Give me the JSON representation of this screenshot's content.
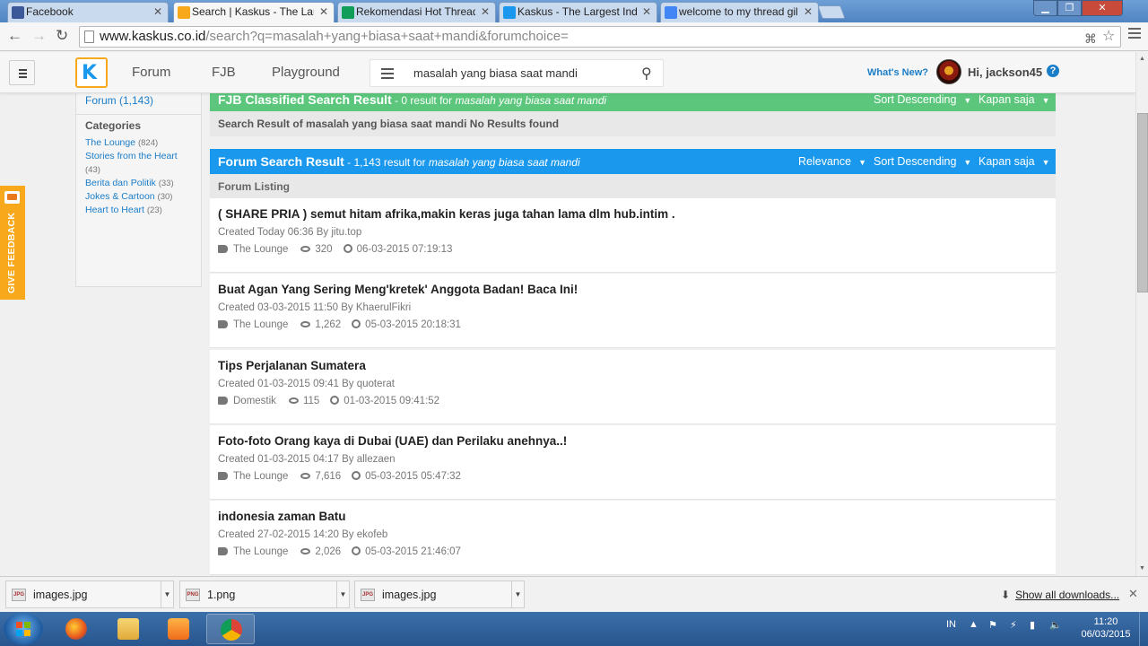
{
  "browser": {
    "tabs": [
      {
        "title": "Facebook",
        "favicon_color": "#3b5998",
        "active": false
      },
      {
        "title": "Search | Kaskus - The Larg",
        "favicon_color": "#1998ed",
        "active": true
      },
      {
        "title": "Rekomendasi Hot Thread",
        "favicon_color": "#0f9d58",
        "active": false
      },
      {
        "title": "Kaskus - The Largest Indo",
        "favicon_color": "#1998ed",
        "active": false
      },
      {
        "title": "welcome to my thread gil",
        "favicon_color": "#4285f4",
        "active": false
      }
    ],
    "url_host": "www.kaskus.co.id",
    "url_path": "/search?q=masalah+yang+biasa+saat+mandi&forumchoice="
  },
  "header": {
    "logo_letter": "K",
    "nav": [
      "Forum",
      "FJB",
      "Playground"
    ],
    "search_value": "masalah yang biasa saat mandi",
    "whats_new": "What's New?",
    "greeting": "Hi, jackson45",
    "help": "?"
  },
  "sidebar": {
    "forum_count": "Forum (1,143)",
    "categories_title": "Categories",
    "categories": [
      {
        "name": "The Lounge",
        "count": "(824)"
      },
      {
        "name": "Stories from the Heart",
        "count": "(43)"
      },
      {
        "name": "Berita dan Politik",
        "count": "(33)"
      },
      {
        "name": "Jokes & Cartoon",
        "count": "(30)"
      },
      {
        "name": "Heart to Heart",
        "count": "(23)"
      }
    ]
  },
  "feedback": {
    "label": "GIVE FEEDBACK"
  },
  "fjb": {
    "title": "FJB Classified Search Result",
    "sub_prefix": " - 0 result for ",
    "sub_query": "masalah yang biasa saat mandi",
    "sort": "Sort Descending",
    "time": "Kapan saja",
    "no_result": "Search Result of masalah yang biasa saat mandi No Results found"
  },
  "forum": {
    "title": "Forum Search Result",
    "sub_prefix": " - 1,143 result for ",
    "sub_query": "masalah yang biasa saat mandi",
    "relevance": "Relevance",
    "sort": "Sort Descending",
    "time": "Kapan saja",
    "listing": "Forum Listing"
  },
  "results": [
    {
      "title": "( SHARE PRIA ) semut hitam afrika,makin keras juga tahan lama dlm hub.intim .",
      "created": "Created Today 06:36 By jitu.top",
      "category": "The Lounge",
      "views": "320",
      "last": "06-03-2015 07:19:13"
    },
    {
      "title": "Buat Agan Yang Sering Meng'kretek' Anggota Badan! Baca Ini!",
      "created": "Created 03-03-2015 11:50 By KhaerulFikri",
      "category": "The Lounge",
      "views": "1,262",
      "last": "05-03-2015 20:18:31"
    },
    {
      "title": "Tips Perjalanan Sumatera",
      "created": "Created 01-03-2015 09:41 By quoterat",
      "category": "Domestik",
      "views": "115",
      "last": "01-03-2015 09:41:52"
    },
    {
      "title": "Foto-foto Orang kaya di Dubai (UAE) dan Perilaku anehnya..!",
      "created": "Created 01-03-2015 04:17 By allezaen",
      "category": "The Lounge",
      "views": "7,616",
      "last": "05-03-2015 05:47:32"
    },
    {
      "title": "indonesia zaman Batu",
      "created": "Created 27-02-2015 14:20 By ekofeb",
      "category": "The Lounge",
      "views": "2,026",
      "last": "05-03-2015 21:46:07"
    }
  ],
  "downloads": {
    "items": [
      {
        "name": "images.jpg",
        "type": "JPG"
      },
      {
        "name": "1.png",
        "type": "PNG"
      },
      {
        "name": "images.jpg",
        "type": "JPG"
      }
    ],
    "show_all": "Show all downloads..."
  },
  "taskbar": {
    "lang": "IN",
    "time": "11:20",
    "date": "06/03/2015"
  }
}
